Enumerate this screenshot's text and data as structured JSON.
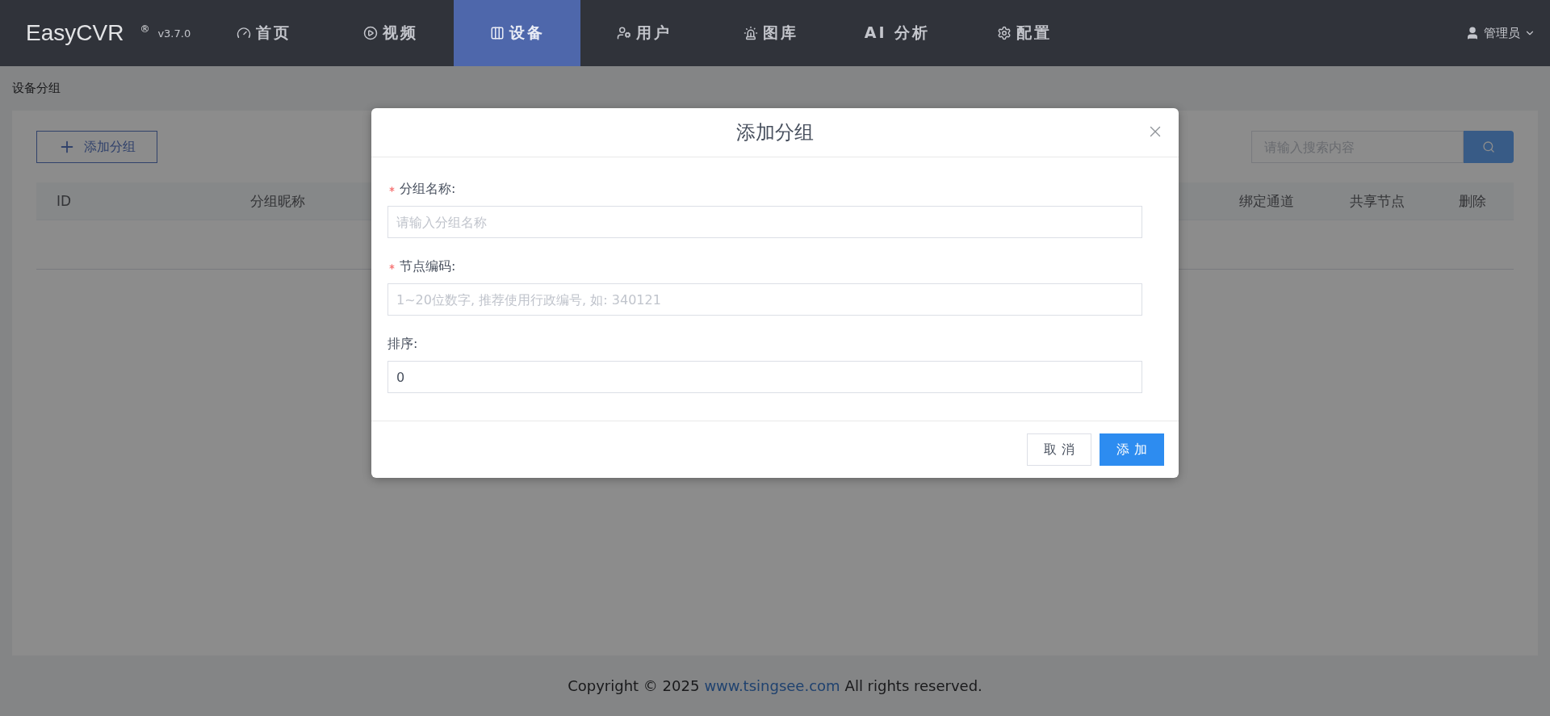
{
  "header": {
    "logo": "EasyCVR",
    "registered": "®",
    "version": "v3.7.0",
    "nav": [
      {
        "label": "首页",
        "selected": false
      },
      {
        "label": "视频",
        "selected": false
      },
      {
        "label": "设备",
        "selected": true
      },
      {
        "label": "用户",
        "selected": false
      },
      {
        "label": "图库",
        "selected": false
      },
      {
        "label": "AI 分析",
        "selected": false
      },
      {
        "label": "配置",
        "selected": false
      }
    ],
    "user": "管理员"
  },
  "breadcrumb": "设备分组",
  "toolbar": {
    "add_button": "添加分组",
    "search": {
      "placeholder": "请输入搜索内容"
    }
  },
  "table": {
    "columns": [
      "ID",
      "分组昵称",
      "绑定通道",
      "共享节点",
      "删除"
    ]
  },
  "dialog": {
    "title": "添加分组",
    "fields": [
      {
        "label": "分组名称:",
        "required": true,
        "placeholder": "请输入分组名称"
      },
      {
        "label": "节点编码:",
        "required": true,
        "placeholder": "1~20位数字, 推荐使用行政编号, 如: 340121"
      },
      {
        "label": "排序:",
        "required": false,
        "value": "0"
      }
    ],
    "buttons": [
      {
        "label": "取 消",
        "kind": "default"
      },
      {
        "label": "添 加",
        "kind": "primary"
      }
    ]
  },
  "footer": {
    "copyright": "Copyright © 2025",
    "link": "www.tsingsee.com",
    "rights": "All rights reserved."
  }
}
